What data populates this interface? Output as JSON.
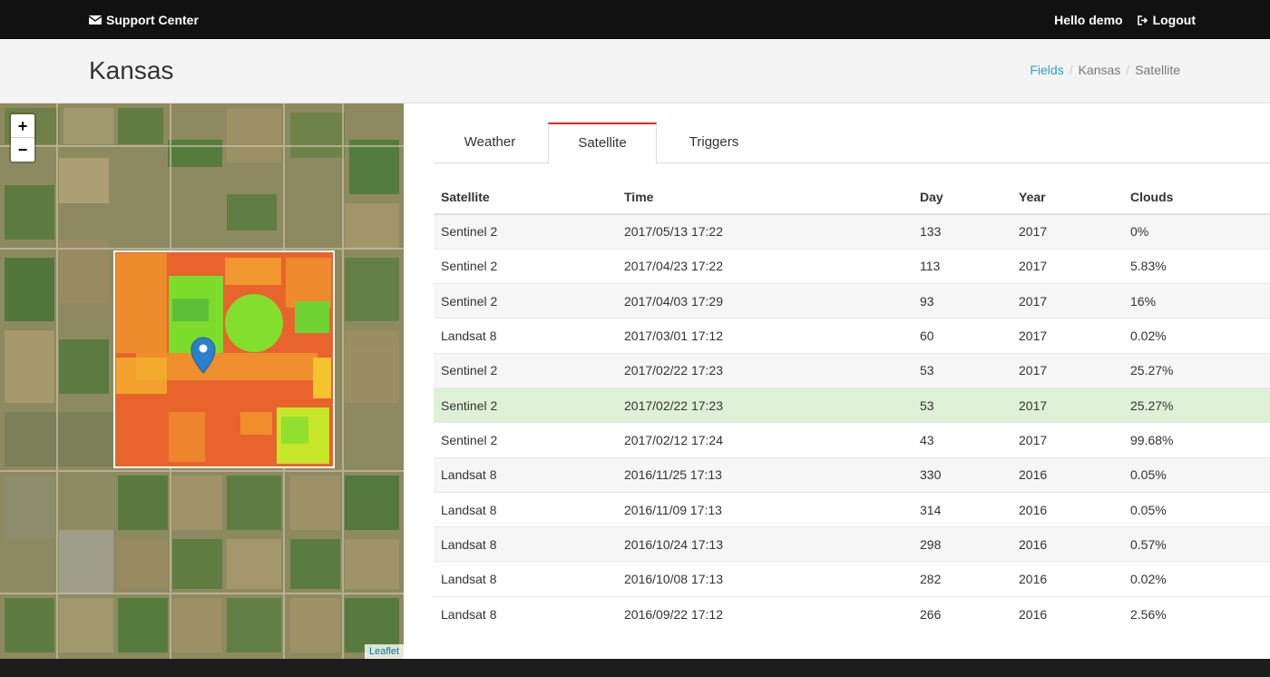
{
  "nav": {
    "brand": "Support Center",
    "greeting": "Hello demo",
    "logout": "Logout"
  },
  "page": {
    "title": "Kansas",
    "breadcrumb": [
      "Fields",
      "Kansas",
      "Satellite"
    ]
  },
  "map": {
    "zoom_in": "+",
    "zoom_out": "−",
    "attribution": "Leaflet"
  },
  "tabs": [
    {
      "label": "Weather",
      "active": false
    },
    {
      "label": "Satellite",
      "active": true
    },
    {
      "label": "Triggers",
      "active": false
    }
  ],
  "table": {
    "headers": [
      "Satellite",
      "Time",
      "Day",
      "Year",
      "Clouds"
    ],
    "rows": [
      [
        "Sentinel 2",
        "2017/05/13 17:22",
        "133",
        "2017",
        "0%"
      ],
      [
        "Sentinel 2",
        "2017/04/23 17:22",
        "113",
        "2017",
        "5.83%"
      ],
      [
        "Sentinel 2",
        "2017/04/03 17:29",
        "93",
        "2017",
        "16%"
      ],
      [
        "Landsat 8",
        "2017/03/01 17:12",
        "60",
        "2017",
        "0.02%"
      ],
      [
        "Sentinel 2",
        "2017/02/22 17:23",
        "53",
        "2017",
        "25.27%"
      ],
      [
        "Sentinel 2",
        "2017/02/22 17:23",
        "53",
        "2017",
        "25.27%"
      ],
      [
        "Sentinel 2",
        "2017/02/12 17:24",
        "43",
        "2017",
        "99.68%"
      ],
      [
        "Landsat 8",
        "2016/11/25 17:13",
        "330",
        "2016",
        "0.05%"
      ],
      [
        "Landsat 8",
        "2016/11/09 17:13",
        "314",
        "2016",
        "0.05%"
      ],
      [
        "Landsat 8",
        "2016/10/24 17:13",
        "298",
        "2016",
        "0.57%"
      ],
      [
        "Landsat 8",
        "2016/10/08 17:13",
        "282",
        "2016",
        "0.02%"
      ],
      [
        "Landsat 8",
        "2016/09/22 17:12",
        "266",
        "2016",
        "2.56%"
      ]
    ],
    "selected_row": 5
  },
  "colors": {
    "accent": "#2a9fd6",
    "active_tab": "#e62222",
    "selected_row": "#dff0d8",
    "ndvi_low": "#e8642c",
    "ndvi_high": "#7bdc2c"
  }
}
